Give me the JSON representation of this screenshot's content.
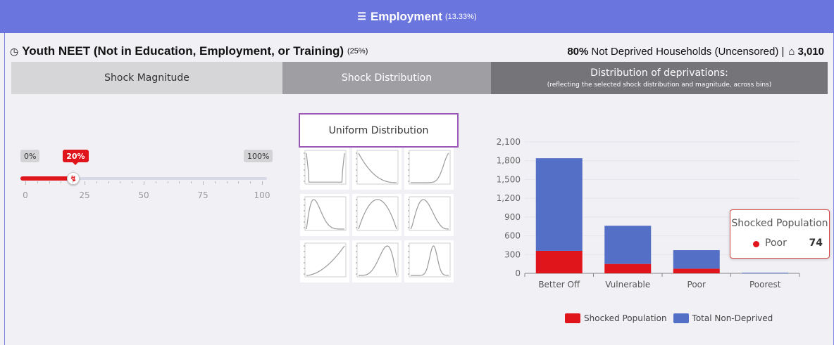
{
  "header": {
    "title": "Employment",
    "weight": "(13.33%)",
    "icon": "layers-icon"
  },
  "indicator": {
    "title": "Youth NEET (Not in Education, Employment, or Training)",
    "weight": "(25%)",
    "icon": "gauge-icon",
    "not_deprived_pct": "80%",
    "not_deprived_label": "Not Deprived Households (Uncensored) |",
    "households": "3,010",
    "households_icon": "home-icon"
  },
  "tabs": {
    "magnitude": "Shock Magnitude",
    "distribution": "Shock Distribution",
    "deprivations_title": "Distribution of deprivations:",
    "deprivations_subtitle": "(reflecting the selected shock distribution and magnitude, across bins)"
  },
  "slider": {
    "min_label": "0%",
    "max_label": "100%",
    "value_label": "20%",
    "value": 20,
    "ticks": [
      "0",
      "25",
      "50",
      "75",
      "100"
    ],
    "handle_icon": "lightning-icon"
  },
  "distribution": {
    "selected": "Uniform Distribution",
    "thumbnails": [
      "u-shaped",
      "decreasing",
      "right-peaked",
      "left-skewed",
      "symmetric-hump",
      "moderate-left-skew",
      "increasing",
      "right-skewed-hump",
      "narrow-right-peak"
    ]
  },
  "chart_data": {
    "type": "bar",
    "stacked": true,
    "categories": [
      "Better Off",
      "Vulnerable",
      "Poor",
      "Poorest"
    ],
    "series": [
      {
        "name": "Shocked Population",
        "color": "#e0151b",
        "values": [
          360,
          150,
          74,
          0
        ]
      },
      {
        "name": "Total Non-Deprived",
        "color": "#5470c6",
        "values": [
          1480,
          610,
          296,
          10
        ]
      }
    ],
    "yticks": [
      "0",
      "300",
      "600",
      "900",
      "1,200",
      "1,500",
      "1,800",
      "2,100"
    ],
    "ylim": [
      0,
      2100
    ],
    "legend": "bottom-center",
    "grid": true
  },
  "tooltip": {
    "title": "Shocked Population",
    "label": "Poor",
    "value": "74"
  },
  "colors": {
    "header": "#6a75de",
    "shock": "#e0151b",
    "total": "#5470c6",
    "selected_border": "#9b59b6"
  }
}
